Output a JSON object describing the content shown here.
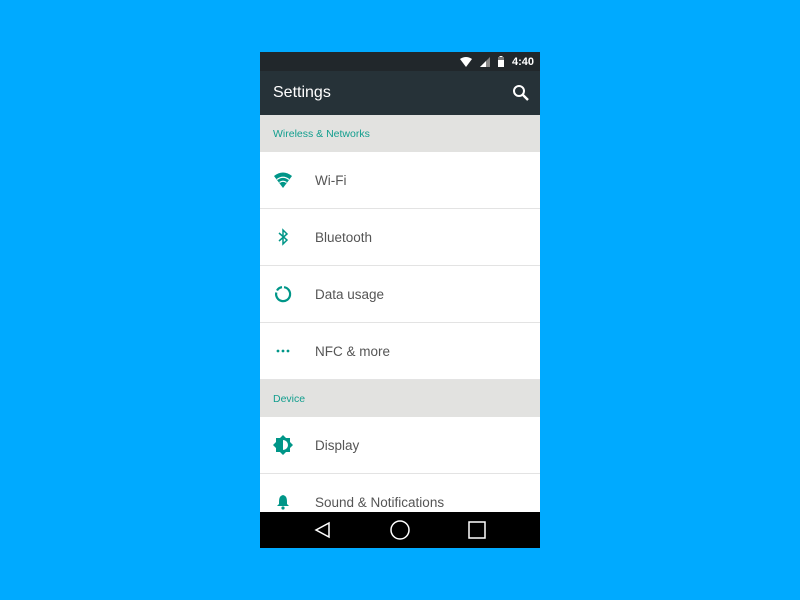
{
  "status_bar": {
    "time": "4:40",
    "icons": [
      "wifi-icon",
      "signal-icon",
      "battery-icon"
    ]
  },
  "app_bar": {
    "title": "Settings",
    "search_icon": "search-icon"
  },
  "accent": "#009688",
  "sections": [
    {
      "title": "Wireless & Networks",
      "items": [
        {
          "label": "Wi-Fi",
          "icon": "wifi-icon"
        },
        {
          "label": "Bluetooth",
          "icon": "bluetooth-icon"
        },
        {
          "label": "Data usage",
          "icon": "data-usage-icon"
        },
        {
          "label": "NFC & more",
          "icon": "more-icon"
        }
      ]
    },
    {
      "title": "Device",
      "items": [
        {
          "label": "Display",
          "icon": "brightness-icon"
        },
        {
          "label": "Sound & Notifications",
          "icon": "bell-icon"
        }
      ]
    }
  ],
  "nav_bar": [
    "back-icon",
    "home-icon",
    "recents-icon"
  ]
}
